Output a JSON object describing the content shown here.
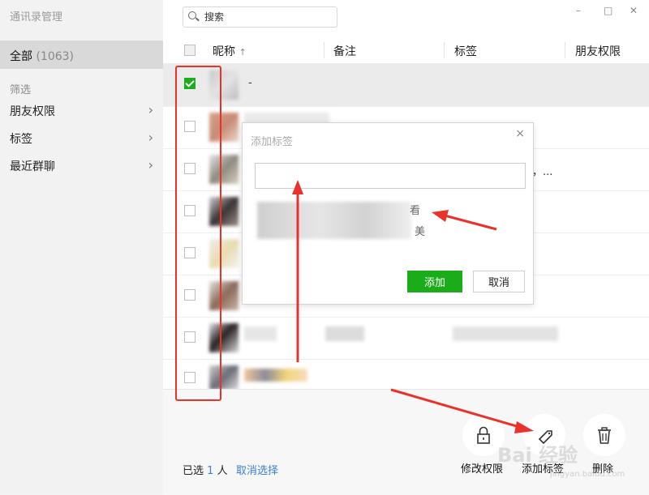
{
  "sidebar": {
    "title": "通讯录管理",
    "all_label": "全部",
    "all_count": "(1063)",
    "filter_label": "筛选",
    "items": [
      {
        "label": "朋友权限"
      },
      {
        "label": "标签"
      },
      {
        "label": "最近群聊"
      }
    ]
  },
  "search": {
    "placeholder": "搜索"
  },
  "window": {
    "minimize": "–",
    "maximize": "□",
    "close": "✕"
  },
  "table": {
    "columns": [
      {
        "label": "昵称"
      },
      {
        "label": "备注"
      },
      {
        "label": "标签"
      },
      {
        "label": "朋友权限"
      }
    ],
    "sort_arrow": "↑",
    "rows": [
      {
        "checked": true,
        "name_tail": "-"
      },
      {
        "checked": false
      },
      {
        "checked": false,
        "tag_tail": "，..."
      },
      {
        "checked": false
      },
      {
        "checked": false
      },
      {
        "checked": false
      },
      {
        "checked": false
      },
      {
        "checked": false
      }
    ]
  },
  "footer": {
    "selected_prefix": "已选",
    "selected_count": "1",
    "selected_suffix": "人",
    "cancel_selection": "取消选择",
    "actions": [
      {
        "label": "修改权限",
        "icon": "lock-icon"
      },
      {
        "label": "添加标签",
        "icon": "tag-icon"
      },
      {
        "label": "删除",
        "icon": "trash-icon"
      }
    ]
  },
  "dialog": {
    "title": "添加标签",
    "close": "×",
    "input_value": "",
    "suggestion_fragments": [
      "看",
      "美"
    ],
    "add_button": "添加",
    "cancel_button": "取消"
  },
  "watermark": {
    "text": "Bai 经验",
    "sub": "jingyan.baidu.com"
  },
  "colors": {
    "accent_green": "#1aad19",
    "link_blue": "#3b7fd4",
    "annotation_red": "#e8322b"
  }
}
